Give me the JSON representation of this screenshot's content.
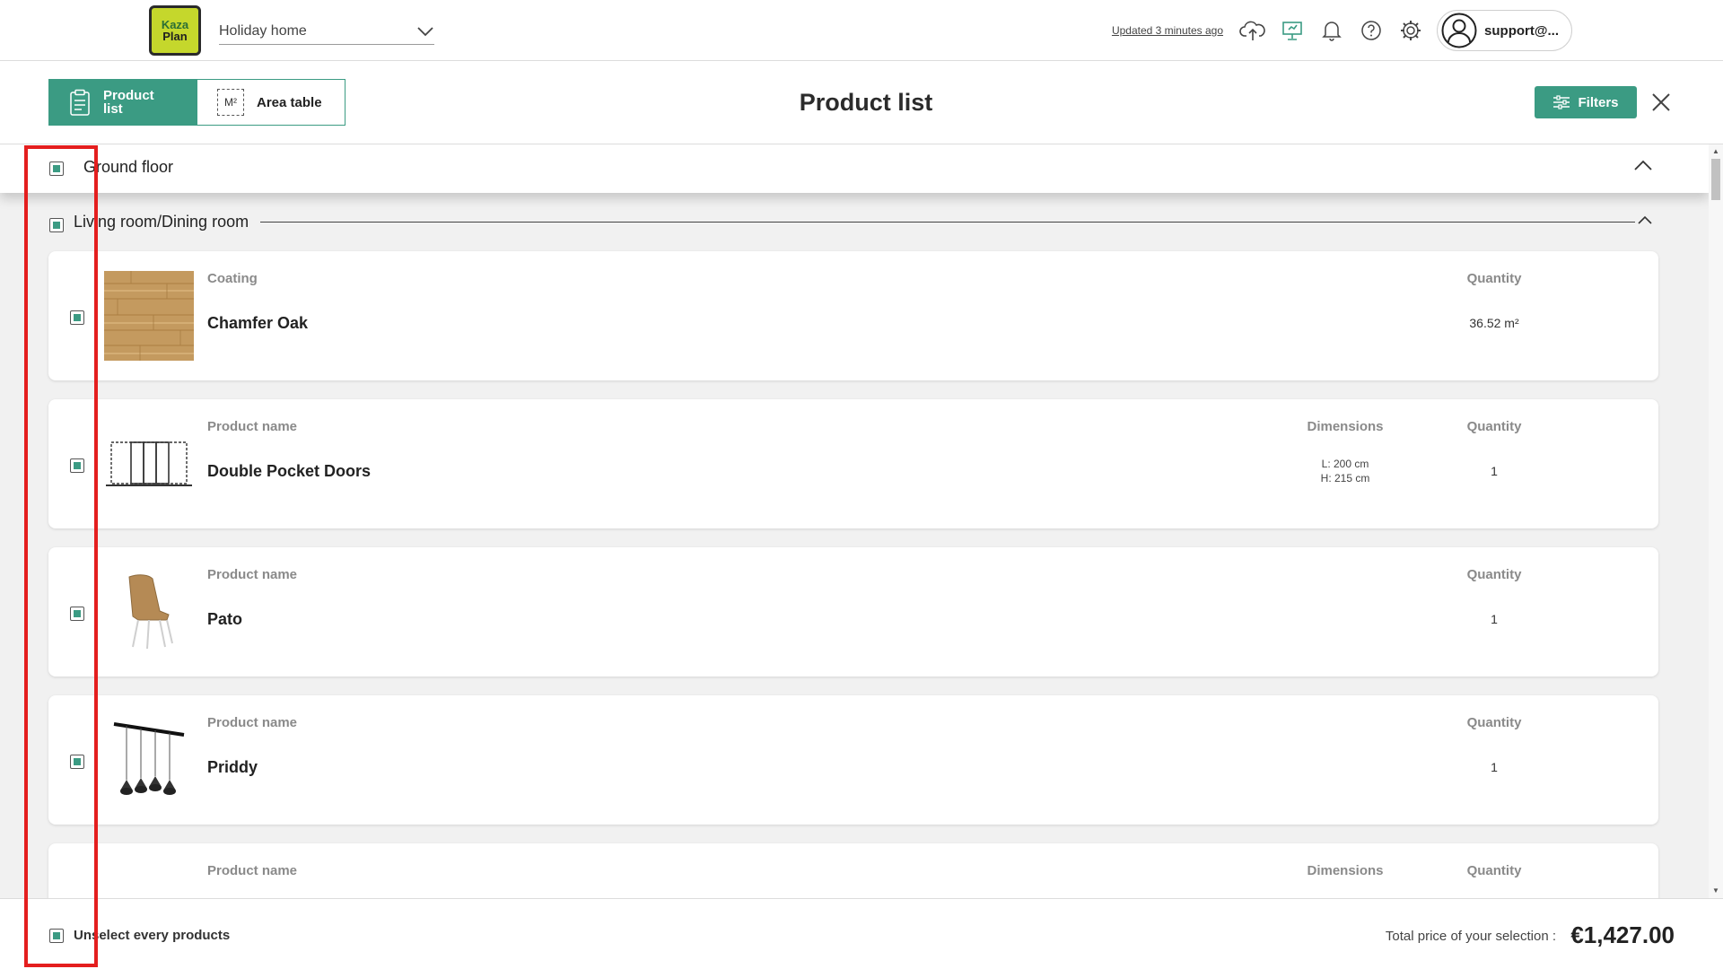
{
  "app": {
    "logo": {
      "line1": "Kaza",
      "line2": "Plan"
    },
    "project_name": "Holiday home",
    "updated_text": "Updated 3 minutes ago",
    "user_label": "support@...",
    "accent_color": "#3b9b83"
  },
  "tabs": [
    {
      "label": "Product list",
      "active": true,
      "icon": "clipboard-icon"
    },
    {
      "label": "Area table",
      "active": false,
      "icon": "m2-icon",
      "icon_text": "M²"
    }
  ],
  "page_title": "Product list",
  "filters_label": "Filters",
  "floor": {
    "label": "Ground floor",
    "checked": true,
    "expanded": true
  },
  "room": {
    "label": "Living room/Dining room",
    "checked": true,
    "expanded": true
  },
  "products": [
    {
      "checked": true,
      "header": "Coating",
      "name": "Chamfer Oak",
      "dimensions_header": "",
      "dimensions": [],
      "quantity_header": "Quantity",
      "quantity": "36.52 m²",
      "thumbnail": "wood-texture"
    },
    {
      "checked": true,
      "header": "Product name",
      "name": "Double Pocket Doors",
      "dimensions_header": "Dimensions",
      "dimensions": [
        "L: 200 cm",
        "H: 215 cm"
      ],
      "quantity_header": "Quantity",
      "quantity": "1",
      "thumbnail": "pocket-door-icon"
    },
    {
      "checked": true,
      "header": "Product name",
      "name": "Pato",
      "dimensions_header": "",
      "dimensions": [],
      "quantity_header": "Quantity",
      "quantity": "1",
      "thumbnail": "chair-image"
    },
    {
      "checked": true,
      "header": "Product name",
      "name": "Priddy",
      "dimensions_header": "",
      "dimensions": [],
      "quantity_header": "Quantity",
      "quantity": "1",
      "thumbnail": "pendant-lamp-image"
    },
    {
      "checked": true,
      "header": "Product name",
      "name": "",
      "dimensions_header": "Dimensions",
      "dimensions": [],
      "quantity_header": "Quantity",
      "quantity": "",
      "thumbnail": "door-icon"
    }
  ],
  "footer": {
    "unselect_label": "Unselect every products",
    "unselect_checked": true,
    "total_label": "Total price of your selection :",
    "total_value": "€1,427.00"
  }
}
